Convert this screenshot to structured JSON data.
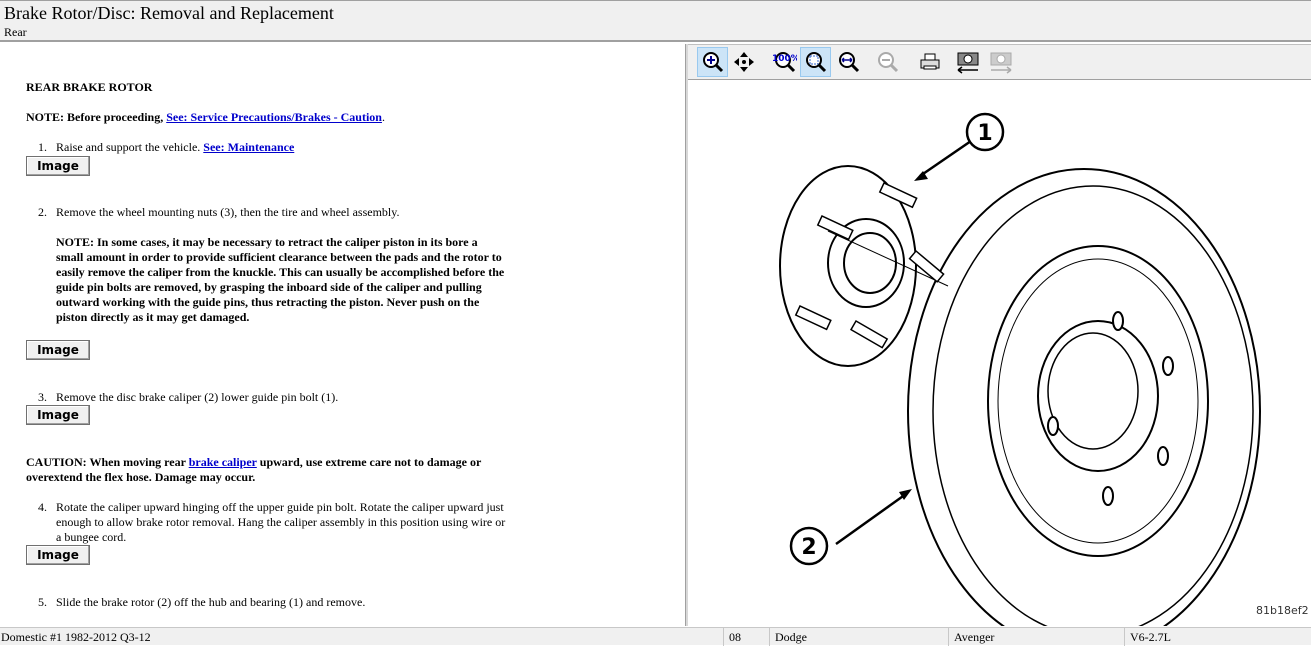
{
  "header": {
    "title": "Brake Rotor/Disc:  Removal and Replacement",
    "subtitle": "Rear"
  },
  "content": {
    "heading": "REAR BRAKE ROTOR",
    "note_prefix": "NOTE: Before proceeding, ",
    "note_link": "See: Service Precautions/Brakes - Caution",
    "note_suffix": ".",
    "steps": [
      {
        "num": "1.",
        "text": "Raise and support the vehicle. ",
        "link": "See: Maintenance"
      },
      {
        "num": "2.",
        "text": "Remove the wheel mounting nuts (3), then the tire and wheel assembly.",
        "note": "NOTE: In some cases, it may be necessary to retract the caliper piston in its bore a small amount in order to provide sufficient clearance between the pads and the rotor to easily remove the caliper from the knuckle. This can usually be accomplished before the guide pin bolts are removed, by grasping the inboard side of the caliper and pulling outward working with the guide pins, thus retracting the piston. Never push on the piston directly as it may get damaged."
      },
      {
        "num": "3.",
        "text": "Remove the disc brake caliper (2) lower guide pin bolt (1)."
      },
      {
        "num": "4.",
        "text": "Rotate the caliper upward hinging off the upper guide pin bolt. Rotate the caliper upward just enough to allow brake rotor removal. Hang the caliper assembly in this position using wire or a bungee cord."
      },
      {
        "num": "5.",
        "text": "Slide the brake rotor (2) off the hub and bearing (1) and remove."
      }
    ],
    "caution_prefix": "CAUTION: When moving rear ",
    "caution_link": "brake caliper",
    "caution_suffix": " upward, use extreme care not to damage or overextend the flex hose. Damage may occur.",
    "image_button": "Image"
  },
  "toolbar": [
    "zoom-in-icon",
    "pan-icon",
    "zoom-100-icon",
    "zoom-fit-icon",
    "zoom-width-icon",
    "zoom-out-icon",
    "print-icon",
    "snapshot-back-icon",
    "snapshot-forward-icon"
  ],
  "figure": {
    "callout1": "1",
    "callout2": "2",
    "code": "81b18ef2"
  },
  "status": {
    "db": "Domestic #1 1982-2012 Q3-12",
    "year": "08",
    "make": "Dodge",
    "model": "Avenger",
    "engine": "V6-2.7L"
  }
}
